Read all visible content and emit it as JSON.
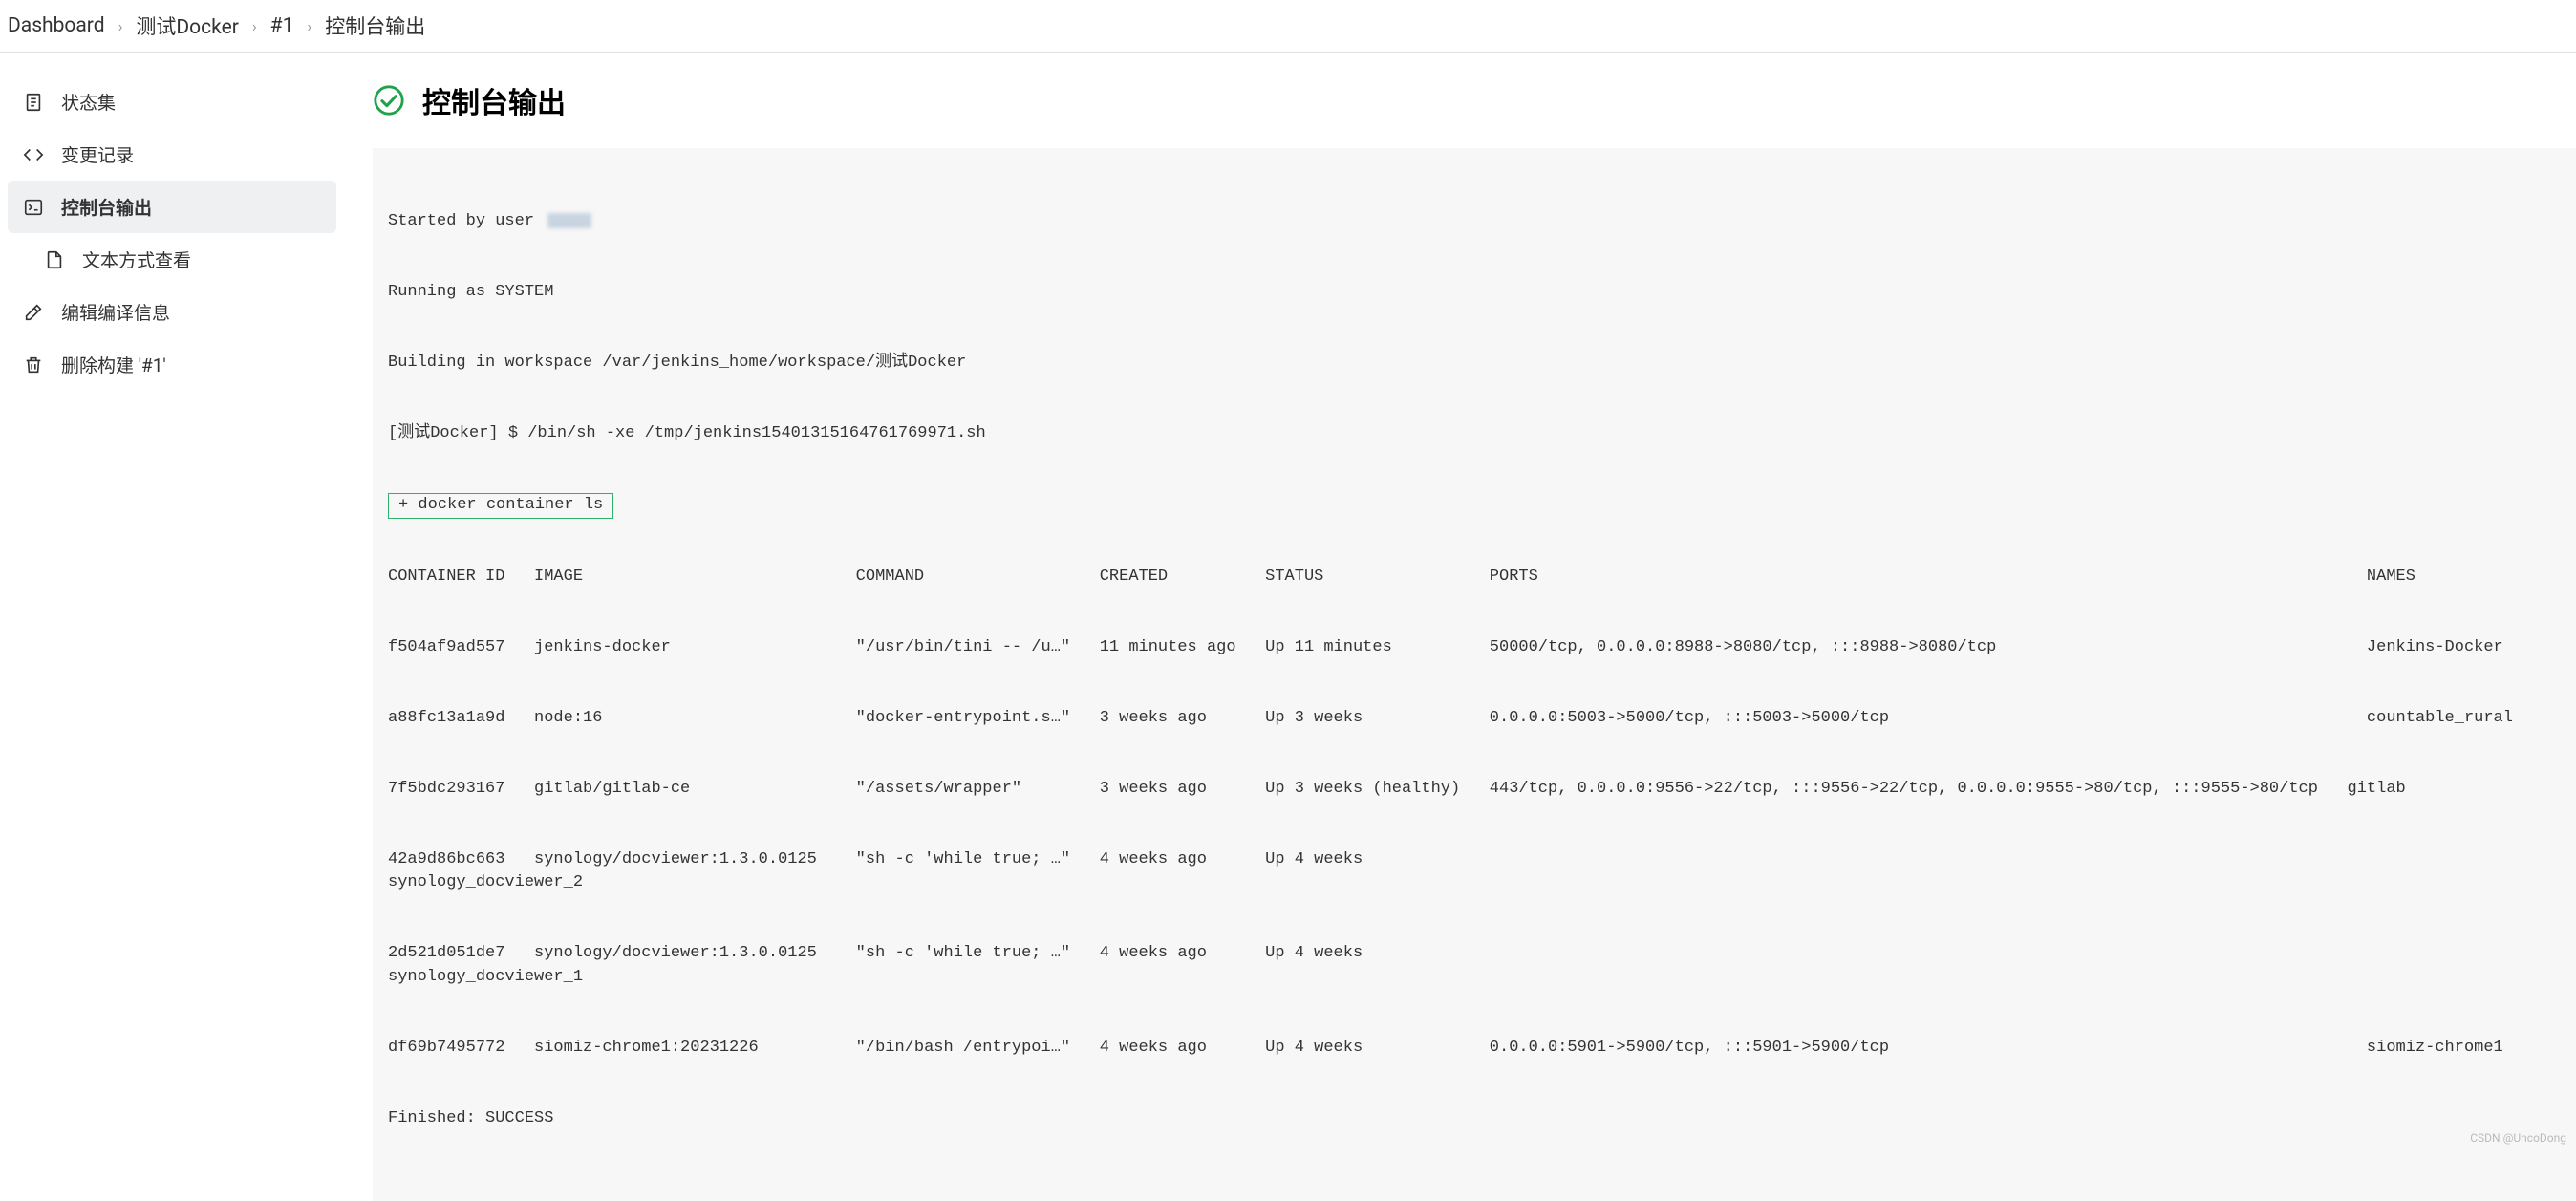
{
  "breadcrumb": {
    "items": [
      "Dashboard",
      "测试Docker",
      "#1",
      "控制台输出"
    ]
  },
  "sidebar": {
    "items": [
      {
        "label": "状态集",
        "icon": "document"
      },
      {
        "label": "变更记录",
        "icon": "code"
      },
      {
        "label": "控制台输出",
        "icon": "terminal",
        "active": true
      },
      {
        "label": "文本方式查看",
        "icon": "file",
        "indent": true
      },
      {
        "label": "编辑编译信息",
        "icon": "edit"
      },
      {
        "label": "删除构建 '#1'",
        "icon": "trash"
      }
    ]
  },
  "page": {
    "title": "控制台输出",
    "status": "success"
  },
  "console": {
    "prefix_started": "Started by user ",
    "line_running": "Running as SYSTEM",
    "line_building": "Building in workspace /var/jenkins_home/workspace/测试Docker",
    "line_shell": "[测试Docker] $ /bin/sh -xe /tmp/jenkins15401315164761769971.sh",
    "line_cmd": "+ docker container ls",
    "line_header": "CONTAINER ID   IMAGE                            COMMAND                  CREATED          STATUS                 PORTS                                                                                     NAMES",
    "line_c1": "f504af9ad557   jenkins-docker                   \"/usr/bin/tini -- /u…\"   11 minutes ago   Up 11 minutes          50000/tcp, 0.0.0.0:8988->8080/tcp, :::8988->8080/tcp                                      Jenkins-Docker",
    "line_c2": "a88fc13a1a9d   node:16                          \"docker-entrypoint.s…\"   3 weeks ago      Up 3 weeks             0.0.0.0:5003->5000/tcp, :::5003->5000/tcp                                                 countable_rural",
    "line_c3": "7f5bdc293167   gitlab/gitlab-ce                 \"/assets/wrapper\"        3 weeks ago      Up 3 weeks (healthy)   443/tcp, 0.0.0.0:9556->22/tcp, :::9556->22/tcp, 0.0.0.0:9555->80/tcp, :::9555->80/tcp   gitlab",
    "line_c4": "42a9d86bc663   synology/docviewer:1.3.0.0125    \"sh -c 'while true; …\"   4 weeks ago      Up 4 weeks                                                                                                       synology_docviewer_2",
    "line_c5": "2d521d051de7   synology/docviewer:1.3.0.0125    \"sh -c 'while true; …\"   4 weeks ago      Up 4 weeks                                                                                                       synology_docviewer_1",
    "line_c6": "df69b7495772   siomiz-chrome1:20231226          \"/bin/bash /entrypoi…\"   4 weeks ago      Up 4 weeks             0.0.0.0:5901->5900/tcp, :::5901->5900/tcp                                                 siomiz-chrome1",
    "line_finished": "Finished: SUCCESS"
  },
  "watermark": "CSDN @UncoDong"
}
